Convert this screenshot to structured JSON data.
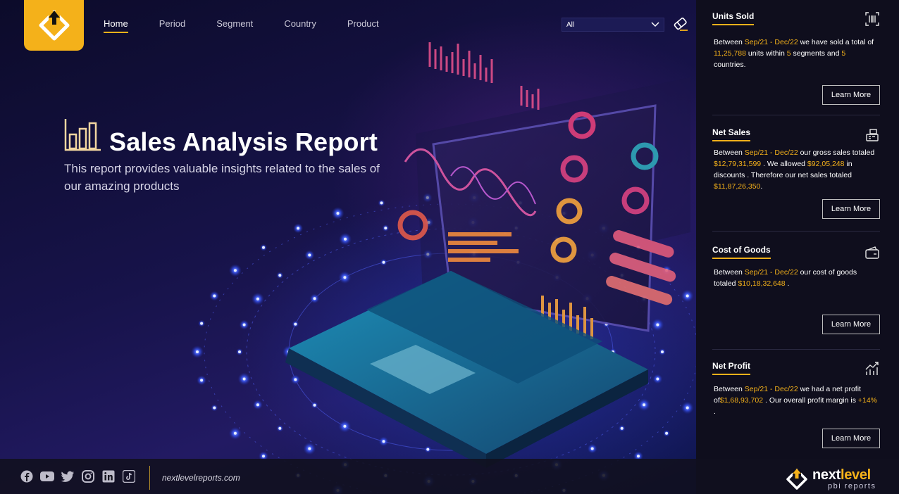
{
  "nav": {
    "items": [
      {
        "label": "Home",
        "active": true
      },
      {
        "label": "Period",
        "active": false
      },
      {
        "label": "Segment",
        "active": false
      },
      {
        "label": "Country",
        "active": false
      },
      {
        "label": "Product",
        "active": false
      }
    ]
  },
  "filter": {
    "value": "All"
  },
  "hero": {
    "title": "Sales Analysis Report",
    "subtitle": "This report provides valuable insights related to the sales of our amazing products"
  },
  "cards": [
    {
      "title": "Units Sold",
      "icon": "barcode-scanner-icon",
      "segments": [
        {
          "t": "Between "
        },
        {
          "t": "Sep/21 - Dec/22",
          "hl": true
        },
        {
          "t": " we have sold a total of "
        },
        {
          "t": "11,25,788",
          "hl": true
        },
        {
          "t": " units within "
        },
        {
          "t": "5",
          "hl": true
        },
        {
          "t": " segments and "
        },
        {
          "t": "5",
          "hl": true
        },
        {
          "t": " countries."
        }
      ],
      "button": "Learn More"
    },
    {
      "title": "Net Sales",
      "icon": "cash-register-icon",
      "segments": [
        {
          "t": "Between "
        },
        {
          "t": "Sep/21 - Dec/22",
          "hl": true
        },
        {
          "t": "  our gross sales totaled "
        },
        {
          "t": "$12,79,31,599",
          "hl": true
        },
        {
          "t": " . We allowed "
        },
        {
          "t": "$92,05,248",
          "hl": true
        },
        {
          "t": " in discounts . Therefore our net sales totaled  "
        },
        {
          "t": "$11,87,26,350",
          "hl": true
        },
        {
          "t": "."
        }
      ],
      "button": "Learn More"
    },
    {
      "title": "Cost of Goods",
      "icon": "wallet-icon",
      "segments": [
        {
          "t": "Between  "
        },
        {
          "t": "Sep/21 - Dec/22",
          "hl": true
        },
        {
          "t": " our cost of goods totaled "
        },
        {
          "t": "$10,18,32,648",
          "hl": true
        },
        {
          "t": " ."
        }
      ],
      "button": "Learn More"
    },
    {
      "title": "Net Profit",
      "icon": "trend-up-icon",
      "segments": [
        {
          "t": "Between  "
        },
        {
          "t": "Sep/21 - Dec/22",
          "hl": true
        },
        {
          "t": " we had a net profit of"
        },
        {
          "t": "$1,68,93,702",
          "hl": true
        },
        {
          "t": " . Our overall profit margin is "
        },
        {
          "t": "+14%",
          "hl": true
        },
        {
          "t": " ."
        }
      ],
      "button": "Learn More"
    }
  ],
  "footer": {
    "social": [
      "facebook-icon",
      "youtube-icon",
      "twitter-icon",
      "instagram-icon",
      "linkedin-icon",
      "tiktok-icon"
    ],
    "link": "nextlevelreports.com",
    "brand": {
      "name_a": "next",
      "name_b": "level",
      "tagline": "pbi reports"
    }
  },
  "colors": {
    "accent": "#f4b11a",
    "panel": "#0f0e1d",
    "background": "#17134a"
  }
}
